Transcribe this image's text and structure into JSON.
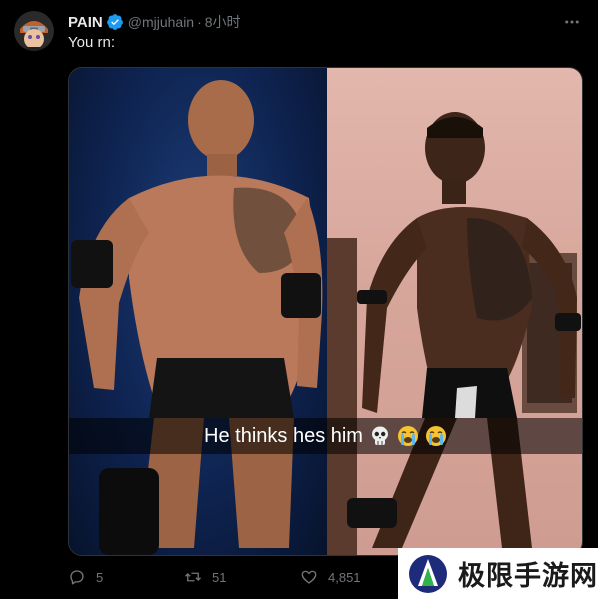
{
  "tweet": {
    "author": {
      "display_name": "PAIN",
      "verified": true,
      "handle": "@mjjuhain",
      "separator": "·",
      "time": "8小时"
    },
    "text": "You rn:",
    "media": {
      "caption": "He thinks hes him",
      "caption_emojis": [
        "skull-emoji",
        "loudly-crying-emoji",
        "loudly-crying-emoji"
      ]
    },
    "actions": {
      "replies": "5",
      "retweets": "51",
      "likes": "4,851"
    }
  },
  "watermark": {
    "text": "极限手游网"
  },
  "colors": {
    "background": "#000000",
    "text_primary": "#e7e9ea",
    "text_secondary": "#71767b",
    "verified_blue": "#1d9bf0",
    "border": "#2f3336"
  }
}
